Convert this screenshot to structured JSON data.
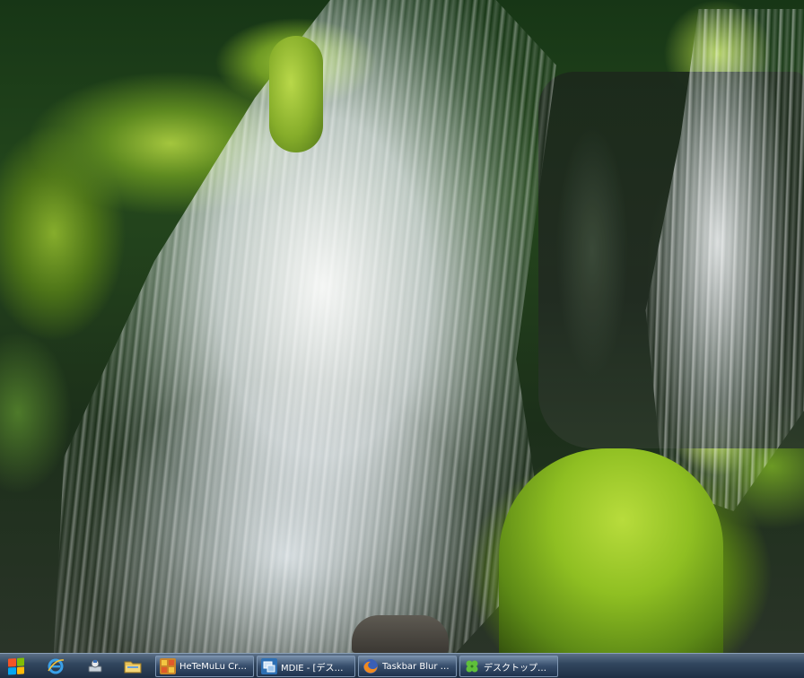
{
  "desktop": {
    "wallpaper": "waterfall-wallpaper"
  },
  "taskbar": {
    "start_icon": "windows-logo-icon",
    "quick_launch": [
      {
        "name": "internet-explorer-icon"
      },
      {
        "name": "show-desktop-icon"
      },
      {
        "name": "windows-explorer-icon"
      }
    ],
    "tasks": [
      {
        "label": "HeTeMuLu Crea...",
        "icon": "hetemulu-app-icon"
      },
      {
        "label": "MDIE - [デスク...",
        "icon": "mdie-app-icon"
      },
      {
        "label": "Taskbar Blur To...",
        "icon": "firefox-icon"
      },
      {
        "label": "デスクトップの...",
        "icon": "clover-icon"
      }
    ],
    "colors": {
      "taskbar_top": "#5b6f86",
      "taskbar_bottom": "#1f2f44",
      "win_red": "#f35325",
      "win_green": "#81bc06",
      "win_blue": "#05a6f0",
      "win_yellow": "#ffba08"
    }
  }
}
